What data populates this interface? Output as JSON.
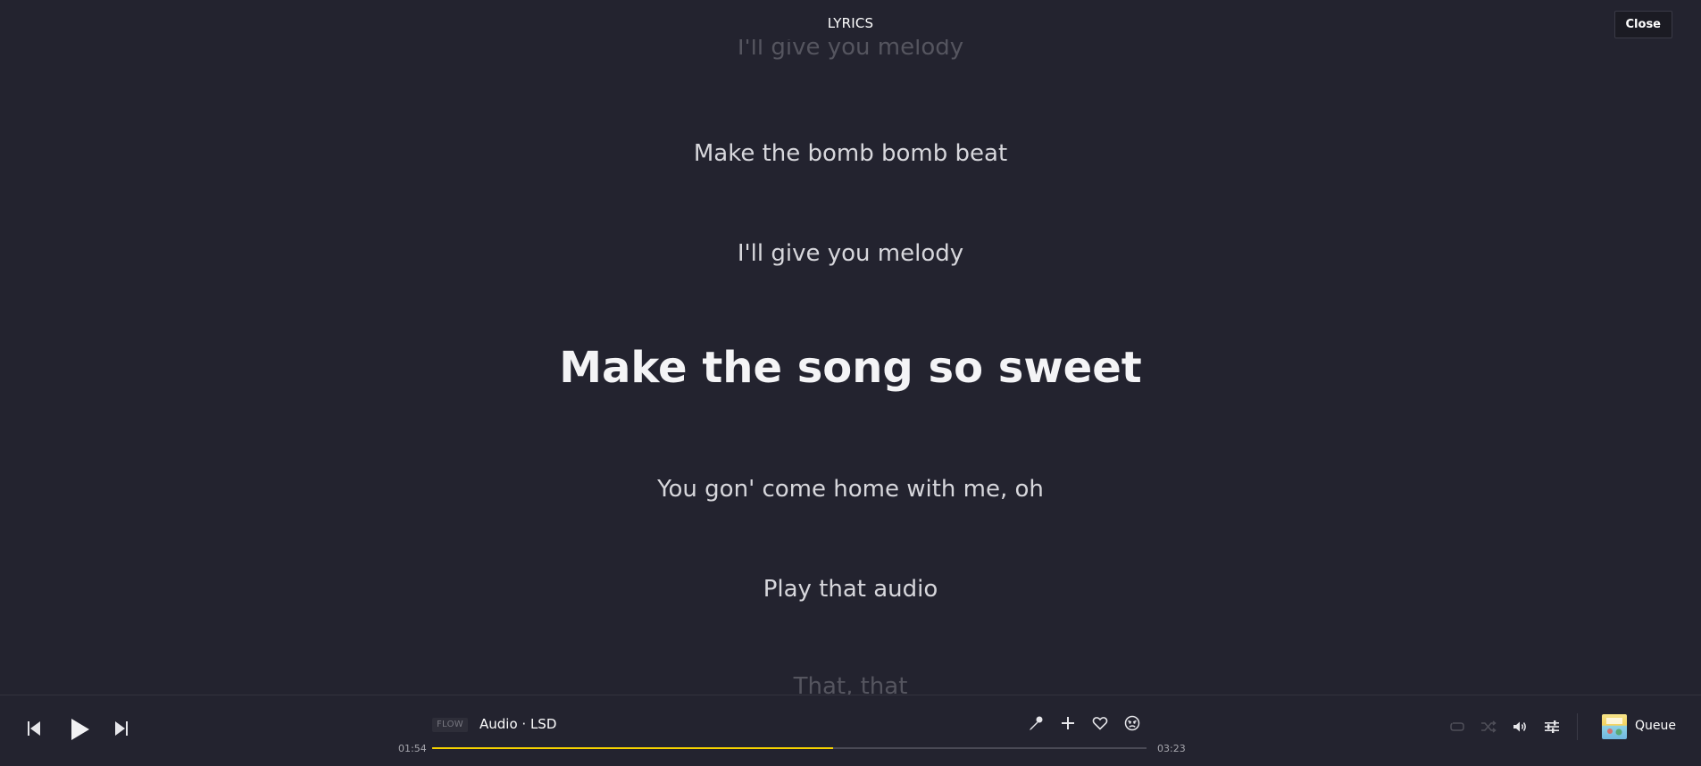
{
  "header": {
    "title": "LYRICS",
    "close_label": "Close"
  },
  "lyrics": {
    "lines": [
      "I'll give you melody",
      "Make the bomb bomb beat",
      "I'll give you melody",
      "Make the song so sweet",
      "You gon' come home with me, oh",
      "Play that audio",
      "That, that"
    ],
    "current_index": 3
  },
  "player": {
    "badge": "FLOW",
    "track_title": "Audio · LSD",
    "elapsed": "01:54",
    "duration": "03:23",
    "progress_fraction": 0.5616,
    "accent_color": "#f5d200",
    "controls": {
      "previous_icon": "skip-previous-icon",
      "play_icon": "play-icon",
      "next_icon": "skip-next-icon",
      "lyrics_icon": "microphone-icon",
      "add_icon": "plus-icon",
      "favorite_icon": "heart-icon",
      "dislike_icon": "frown-icon",
      "repeat_icon": "repeat-icon",
      "shuffle_icon": "shuffle-icon",
      "volume_icon": "volume-icon",
      "equalizer_icon": "equalizer-icon"
    },
    "queue_label": "Queue"
  }
}
